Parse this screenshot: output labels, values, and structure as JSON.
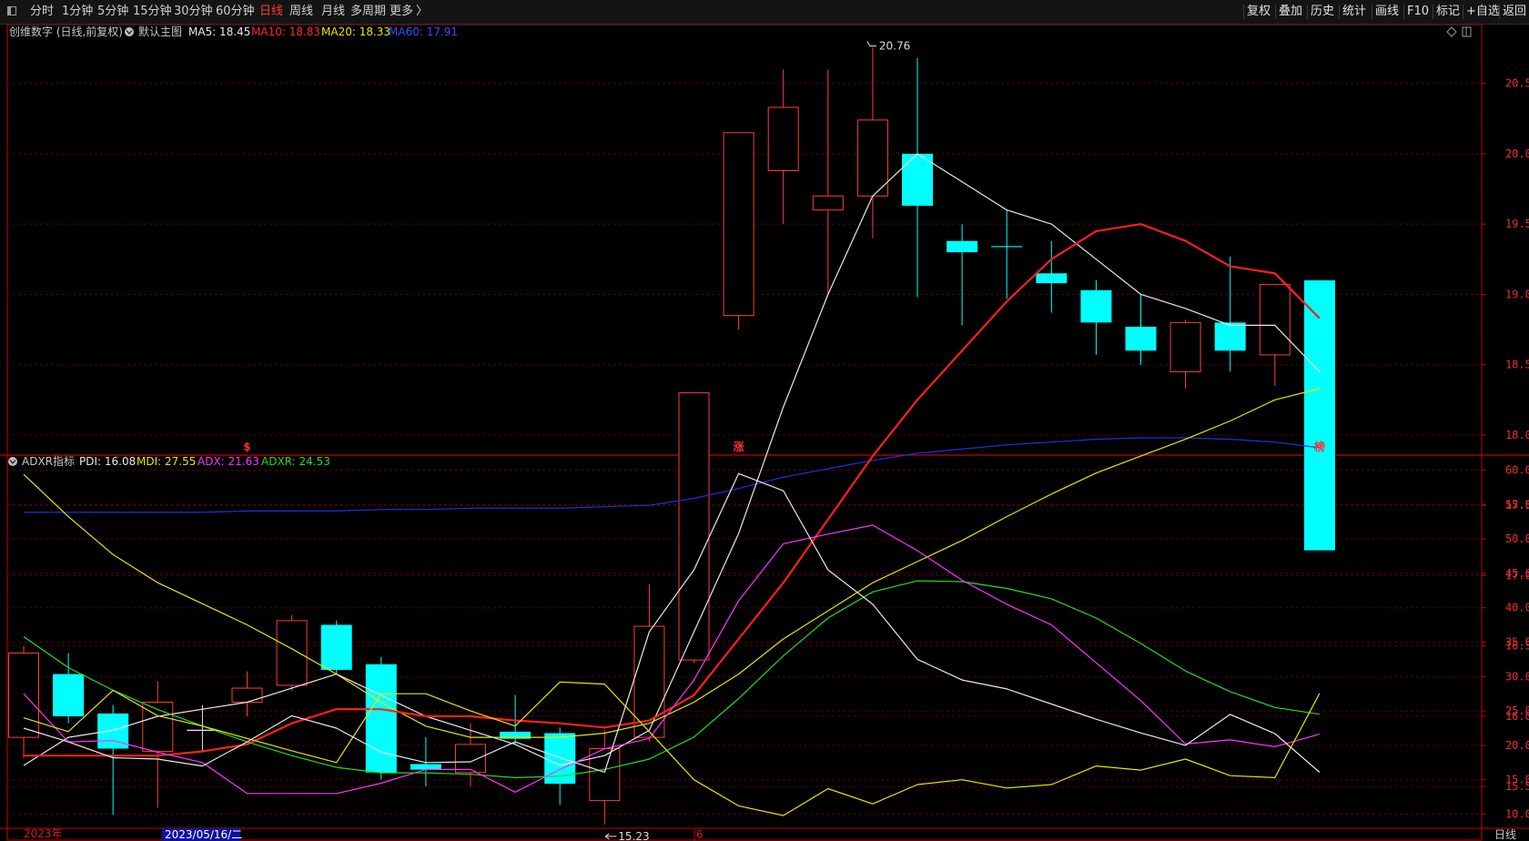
{
  "toolbar": {
    "left_items": [
      {
        "label": "分时",
        "active": false
      },
      {
        "label": "1分钟",
        "active": false
      },
      {
        "label": "5分钟",
        "active": false
      },
      {
        "label": "15分钟",
        "active": false
      },
      {
        "label": "30分钟",
        "active": false
      },
      {
        "label": "60分钟",
        "active": false
      },
      {
        "label": "日线",
        "active": true
      },
      {
        "label": "周线",
        "active": false
      },
      {
        "label": "月线",
        "active": false
      },
      {
        "label": "多周期",
        "active": false
      },
      {
        "label": "更多",
        "active": false
      }
    ],
    "right_items": [
      "复权",
      "叠加",
      "历史",
      "统计",
      "画线",
      "F10",
      "标记",
      "+自选",
      "返回"
    ]
  },
  "main_panel": {
    "stock_title": "创维数字 (日线,前复权)",
    "template_label": "默认主图",
    "ma_labels": [
      {
        "label": "MA5: 18.45",
        "color": "#e8e8e8"
      },
      {
        "label": "MA10: 18.83",
        "color": "#ff2828"
      },
      {
        "label": "MA20: 18.33",
        "color": "#e6e600"
      },
      {
        "label": "MA60: 17.91",
        "color": "#3050ff"
      }
    ],
    "high_annotation": "20.76",
    "low_annotation": "15.23",
    "markers": [
      {
        "text": "$",
        "index": 5
      },
      {
        "text": "涨",
        "index": 16
      },
      {
        "text": "榜",
        "index": 29
      }
    ],
    "y_axis_ticks": [
      "20.50",
      "20.00",
      "19.50",
      "19.00",
      "18.50",
      "18.00",
      "17.50",
      "17.00",
      "16.50",
      "16.00",
      "15.50"
    ]
  },
  "sub_panel": {
    "indicator_name": "ADXR指标",
    "values": [
      {
        "label": "PDI: 16.08",
        "color": "#e8e8e8"
      },
      {
        "label": "MDI: 27.55",
        "color": "#e6e600"
      },
      {
        "label": "ADX: 21.63",
        "color": "#ff33ff"
      },
      {
        "label": "ADXR: 24.53",
        "color": "#22dd22"
      }
    ],
    "y_axis_ticks": [
      "60.00",
      "55.00",
      "50.00",
      "45.00",
      "40.00",
      "35.00",
      "30.00",
      "25.00",
      "20.00",
      "15.00",
      "10.00"
    ]
  },
  "bottom_axis": {
    "year_label": "2023年",
    "cursor_date": "2023/05/16/二",
    "month_label": "6",
    "period_label": "日线"
  },
  "colors": {
    "up": "#ff3c3c",
    "down": "#00ffff",
    "grid": "#5a0000",
    "axis": "#c80000",
    "ma5": "#e8e8e8",
    "ma10": "#ff2020",
    "ma20": "#e6e600",
    "ma60": "#2030e0",
    "pdi": "#e8e8e8",
    "mdi": "#e6e600",
    "adx": "#ff33ff",
    "adxr": "#22dd22"
  },
  "chart_data": {
    "type": "candlestick",
    "price_ylim": [
      15.1,
      20.7
    ],
    "indicator_ylim": [
      9.3,
      61.5
    ],
    "candles": [
      {
        "o": 15.85,
        "c": 16.45,
        "h": 16.5,
        "l": 15.7
      },
      {
        "o": 16.3,
        "c": 16.0,
        "h": 16.45,
        "l": 15.95
      },
      {
        "o": 16.02,
        "c": 15.77,
        "h": 16.08,
        "l": 15.3
      },
      {
        "o": 15.75,
        "c": 16.1,
        "h": 16.25,
        "l": 15.35
      },
      {
        "o": 15.9,
        "c": 15.9,
        "h": 16.08,
        "l": 15.75
      },
      {
        "o": 16.1,
        "c": 16.2,
        "h": 16.32,
        "l": 16.0
      },
      {
        "o": 16.22,
        "c": 16.68,
        "h": 16.72,
        "l": 16.18
      },
      {
        "o": 16.65,
        "c": 16.33,
        "h": 16.68,
        "l": 16.3
      },
      {
        "o": 16.37,
        "c": 15.6,
        "h": 16.42,
        "l": 15.55
      },
      {
        "o": 15.66,
        "c": 15.62,
        "h": 15.85,
        "l": 15.5
      },
      {
        "o": 15.6,
        "c": 15.8,
        "h": 15.95,
        "l": 15.5
      },
      {
        "o": 15.89,
        "c": 15.84,
        "h": 16.15,
        "l": 15.8
      },
      {
        "o": 15.88,
        "c": 15.52,
        "h": 15.92,
        "l": 15.37
      },
      {
        "o": 15.4,
        "c": 15.77,
        "h": 15.9,
        "l": 15.23
      },
      {
        "o": 15.85,
        "c": 16.64,
        "h": 16.94,
        "l": 15.82
      },
      {
        "o": 16.4,
        "c": 18.3,
        "h": 18.3,
        "l": 16.38
      },
      {
        "o": 18.85,
        "c": 20.15,
        "h": 20.15,
        "l": 18.75
      },
      {
        "o": 19.88,
        "c": 20.33,
        "h": 20.6,
        "l": 19.5
      },
      {
        "o": 19.6,
        "c": 19.7,
        "h": 20.6,
        "l": 19.0
      },
      {
        "o": 19.7,
        "c": 20.24,
        "h": 20.76,
        "l": 19.4
      },
      {
        "o": 20.0,
        "c": 19.63,
        "h": 20.68,
        "l": 18.98
      },
      {
        "o": 19.38,
        "c": 19.3,
        "h": 19.5,
        "l": 18.78
      },
      {
        "o": 19.34,
        "c": 19.34,
        "h": 19.6,
        "l": 18.97
      },
      {
        "o": 19.15,
        "c": 19.08,
        "h": 19.38,
        "l": 18.87
      },
      {
        "o": 19.03,
        "c": 18.8,
        "h": 19.1,
        "l": 18.57
      },
      {
        "o": 18.77,
        "c": 18.6,
        "h": 19.0,
        "l": 18.5
      },
      {
        "o": 18.45,
        "c": 18.8,
        "h": 18.82,
        "l": 18.33
      },
      {
        "o": 18.8,
        "c": 18.6,
        "h": 19.27,
        "l": 18.45
      },
      {
        "o": 18.57,
        "c": 19.07,
        "h": 19.07,
        "l": 18.35
      },
      {
        "o": 19.1,
        "c": 17.18,
        "h": 19.1,
        "l": 17.18
      }
    ],
    "ma5": [
      15.65,
      15.85,
      15.9,
      16.0,
      16.05,
      16.1,
      16.2,
      16.3,
      16.15,
      16.0,
      15.9,
      15.8,
      15.65,
      15.72,
      15.9,
      16.6,
      17.3,
      18.2,
      19.0,
      19.7,
      20.0,
      19.8,
      19.6,
      19.5,
      19.25,
      19.0,
      18.9,
      18.78,
      18.78,
      18.45
    ],
    "ma10": [
      15.72,
      15.72,
      15.72,
      15.72,
      15.75,
      15.8,
      15.95,
      16.05,
      16.05,
      16.0,
      16.0,
      15.97,
      15.95,
      15.92,
      15.97,
      16.15,
      16.55,
      16.95,
      17.4,
      17.85,
      18.25,
      18.6,
      18.95,
      19.25,
      19.45,
      19.5,
      19.38,
      19.2,
      19.15,
      18.83
    ],
    "ma20": [
      17.72,
      17.42,
      17.15,
      16.95,
      16.8,
      16.65,
      16.48,
      16.3,
      16.1,
      15.93,
      15.85,
      15.85,
      15.85,
      15.88,
      15.95,
      16.1,
      16.3,
      16.55,
      16.75,
      16.95,
      17.1,
      17.25,
      17.42,
      17.58,
      17.73,
      17.85,
      17.97,
      18.1,
      18.25,
      18.33
    ],
    "ma60": [
      17.45,
      17.45,
      17.45,
      17.45,
      17.45,
      17.46,
      17.46,
      17.46,
      17.47,
      17.47,
      17.48,
      17.48,
      17.48,
      17.49,
      17.5,
      17.55,
      17.62,
      17.7,
      17.76,
      17.82,
      17.87,
      17.9,
      17.93,
      17.95,
      17.97,
      17.98,
      17.98,
      17.97,
      17.95,
      17.91
    ],
    "pdi": [
      22.5,
      20.5,
      18.2,
      18.0,
      17.0,
      20.5,
      24.3,
      22.5,
      19.0,
      17.5,
      17.6,
      20.5,
      18.2,
      16.1,
      36.5,
      45.5,
      59.5,
      57.0,
      45.5,
      40.5,
      32.5,
      29.5,
      28.2,
      26.0,
      23.8,
      21.8,
      20.0,
      24.5,
      21.7,
      16.08
    ],
    "mdi": [
      24.0,
      22.0,
      28.0,
      24.3,
      22.8,
      21.0,
      19.2,
      17.5,
      27.5,
      27.5,
      25.0,
      22.8,
      29.2,
      28.9,
      22.0,
      15.0,
      11.2,
      9.8,
      13.7,
      11.5,
      14.3,
      15.0,
      13.8,
      14.3,
      17.0,
      16.4,
      18.0,
      15.6,
      15.3,
      27.55
    ],
    "adx": [
      27.5,
      20.5,
      20.7,
      19.0,
      17.5,
      13.0,
      13.0,
      13.0,
      14.5,
      16.5,
      16.5,
      13.2,
      16.5,
      19.5,
      21.0,
      29.5,
      41.0,
      49.3,
      50.7,
      52.0,
      48.3,
      44.0,
      40.5,
      37.5,
      32.0,
      26.5,
      20.2,
      20.8,
      19.8,
      21.63
    ],
    "adxr": [
      35.8,
      31.3,
      28.0,
      25.2,
      22.8,
      20.5,
      18.5,
      16.8,
      16.0,
      16.0,
      15.8,
      15.3,
      15.5,
      16.5,
      18.0,
      21.2,
      26.8,
      33.0,
      38.5,
      42.3,
      43.9,
      43.8,
      42.8,
      41.3,
      38.5,
      34.8,
      30.8,
      27.8,
      25.5,
      24.53
    ]
  }
}
